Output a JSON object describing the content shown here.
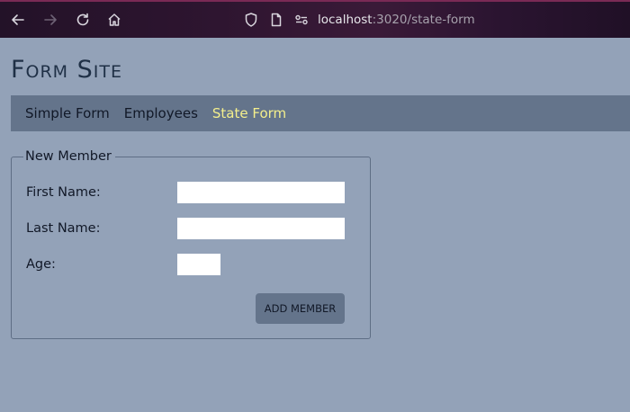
{
  "browser": {
    "url_host": "localhost",
    "url_path": ":3020/state-form"
  },
  "site": {
    "title": "Form Site"
  },
  "nav": {
    "items": [
      {
        "label": "Simple Form"
      },
      {
        "label": "Employees"
      },
      {
        "label": "State Form"
      }
    ]
  },
  "form": {
    "legend": "New Member",
    "first_name": {
      "label": "First Name:",
      "value": ""
    },
    "last_name": {
      "label": "Last Name:",
      "value": ""
    },
    "age": {
      "label": "Age:",
      "value": ""
    },
    "submit_label": "ADD MEMBER"
  },
  "colors": {
    "page_background": "#93a2b8",
    "nav_background": "#64748b",
    "active_nav_text": "#f4ef8c"
  }
}
